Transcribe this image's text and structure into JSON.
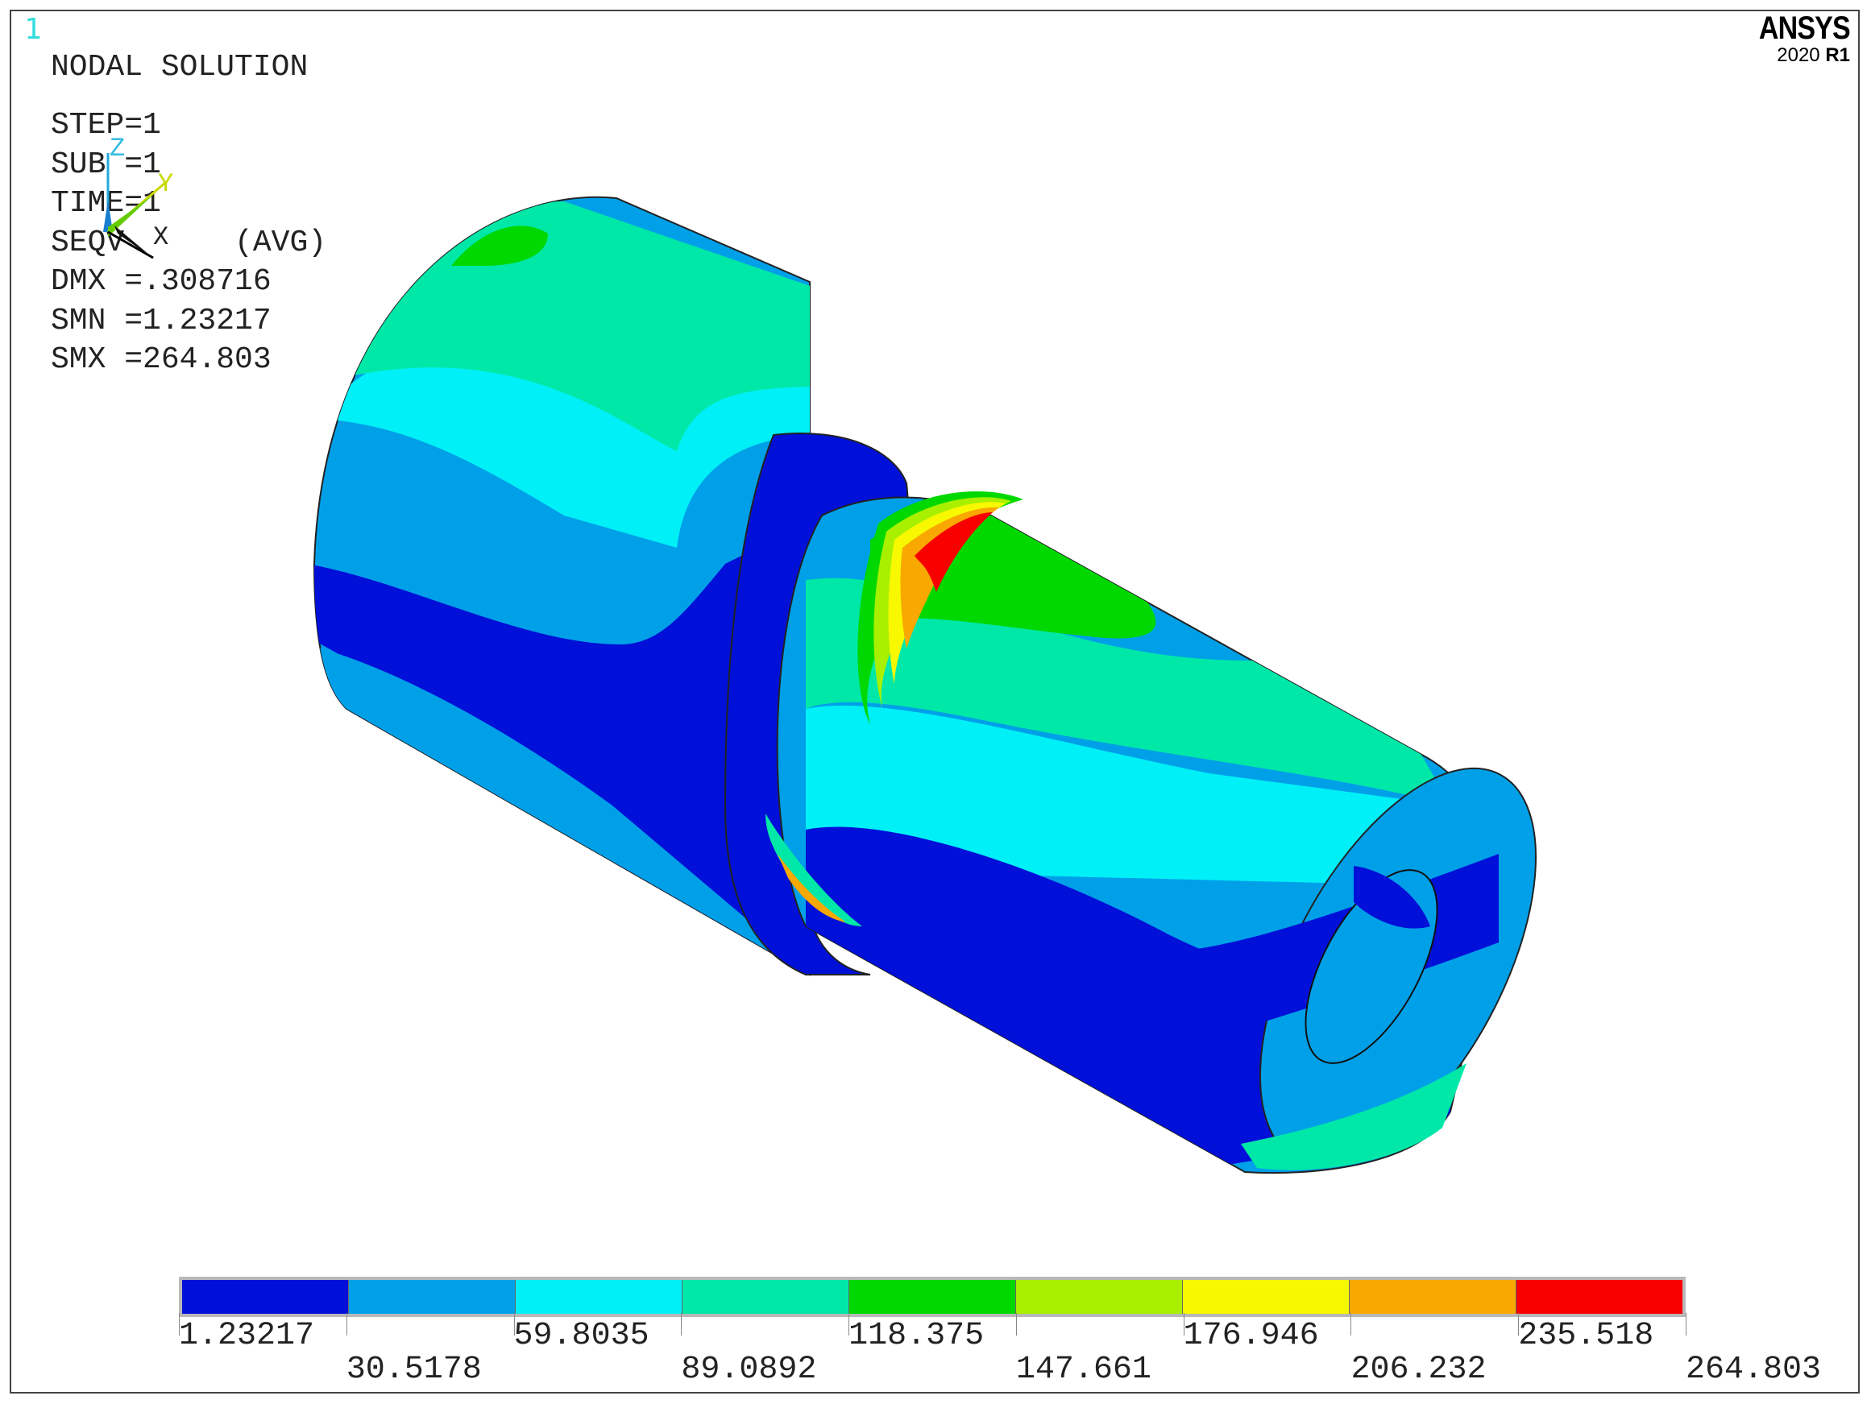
{
  "window_number": "1",
  "logo": {
    "brand": "ANSYS",
    "version_year": "2020",
    "version_release": "R1"
  },
  "info": {
    "title": "NODAL SOLUTION",
    "step": "STEP=1",
    "sub": "SUB =1",
    "time": "TIME=1",
    "result": "SEQV      (AVG)",
    "dmx": "DMX =.308716",
    "smn": "SMN =1.23217",
    "smx": "SMX =264.803"
  },
  "triad": {
    "z": "Z",
    "y": "Y",
    "x": "X"
  },
  "legend": {
    "colors": [
      "#0010d8",
      "#00a0e8",
      "#00f0f8",
      "#00e8a8",
      "#00d800",
      "#a8f000",
      "#f8f800",
      "#f8a800",
      "#f80000"
    ],
    "values_top": [
      "1.23217",
      "59.8035",
      "118.375",
      "176.946",
      "235.518"
    ],
    "values_bottom": [
      "30.5178",
      "89.0892",
      "147.661",
      "206.232",
      "264.803"
    ]
  }
}
